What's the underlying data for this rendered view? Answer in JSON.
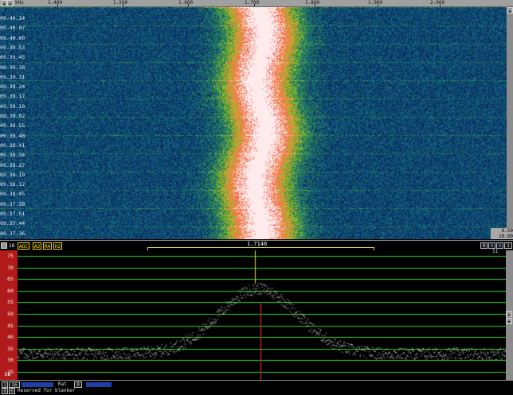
{
  "freq_scale": {
    "unit": "kHz",
    "ticks": [
      "1.400",
      "1.500",
      "1.600",
      "1.700",
      "1.800",
      "1.900",
      "2.000"
    ]
  },
  "waterfall": {
    "timestamps": [
      "09.40.14",
      "09.40.07",
      "09.40.00",
      "09.39.53",
      "09.39.45",
      "09.39.38",
      "09.39.31",
      "09.39.24",
      "09.39.17",
      "09.39.10",
      "09.39.02",
      "09.38.55",
      "09.38.48",
      "09.38.41",
      "09.38.34",
      "09.38.27",
      "09.38.19",
      "09.38.12",
      "09.38.05",
      "09.37.58",
      "09.37.51",
      "09.37.44",
      "09.37.36"
    ],
    "right_top": "0.50",
    "right_bottom": "10.00",
    "colors": {
      "noise": "#143a6b",
      "mid": "#3f9a2e",
      "hot": "#ff5a2a",
      "peak": "#ffffff"
    }
  },
  "controls": {
    "left_num": "10",
    "agc": "AGC",
    "a2": "A2",
    "r4": "R4",
    "h2": "H2",
    "center_freq": "1.7146",
    "right_num": "0",
    "right_b": "0",
    "right_c": "0",
    "right_d": "1"
  },
  "spectrum": {
    "y_ticks": [
      "75",
      "70",
      "65",
      "60",
      "55",
      "50",
      "45",
      "40",
      "35",
      "30",
      "25"
    ],
    "y_range": [
      25,
      75
    ],
    "db_label": "DB",
    "noise_level": 33,
    "peak_level": 61,
    "right_top_label": "11",
    "grid_color": "#2ecb2e",
    "marker_color": "#ff3030"
  },
  "status": {
    "field1": "1",
    "field2": "16",
    "rat_label": "Rat",
    "rat_value": "0",
    "field3": "0",
    "field4": "0",
    "reserved": "Reserved for blanker"
  }
}
